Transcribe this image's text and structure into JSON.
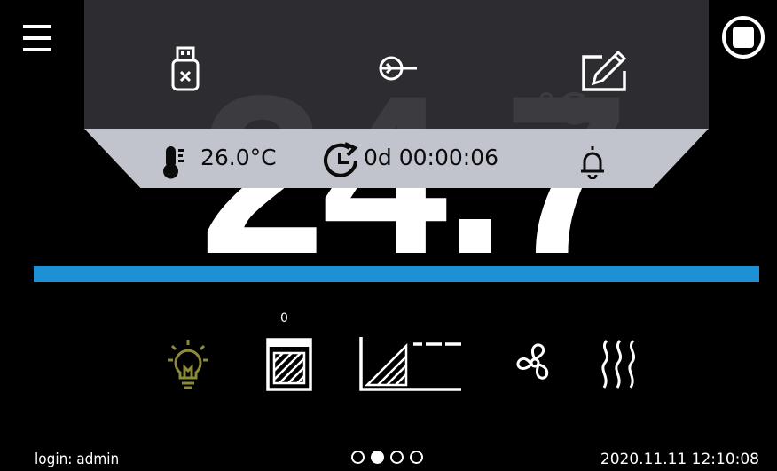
{
  "measurement": {
    "value": "24.7",
    "unit": "°C"
  },
  "info_bar": {
    "setpoint": "26.0°C",
    "timer": "0d 00:00:06"
  },
  "status_icons": {
    "door_open_count": "0"
  },
  "footer": {
    "login": "login: admin",
    "datetime": "2020.11.11  12:10:08",
    "pages": 4,
    "active_page": 2
  },
  "colors": {
    "progress": "#1e90d6",
    "info_bar": "#c2c4cd",
    "overlay": "#303034",
    "light_icon_inactive": "#8a8a3a"
  },
  "icons": [
    "menu-icon",
    "stop-icon",
    "usb-disabled-icon",
    "login-icon",
    "edit-program-icon",
    "thermometer-icon",
    "timer-icon",
    "alarm-bell-icon",
    "light-bulb-icon",
    "door-icon",
    "program-ramp-icon",
    "fan-icon",
    "heating-icon"
  ]
}
